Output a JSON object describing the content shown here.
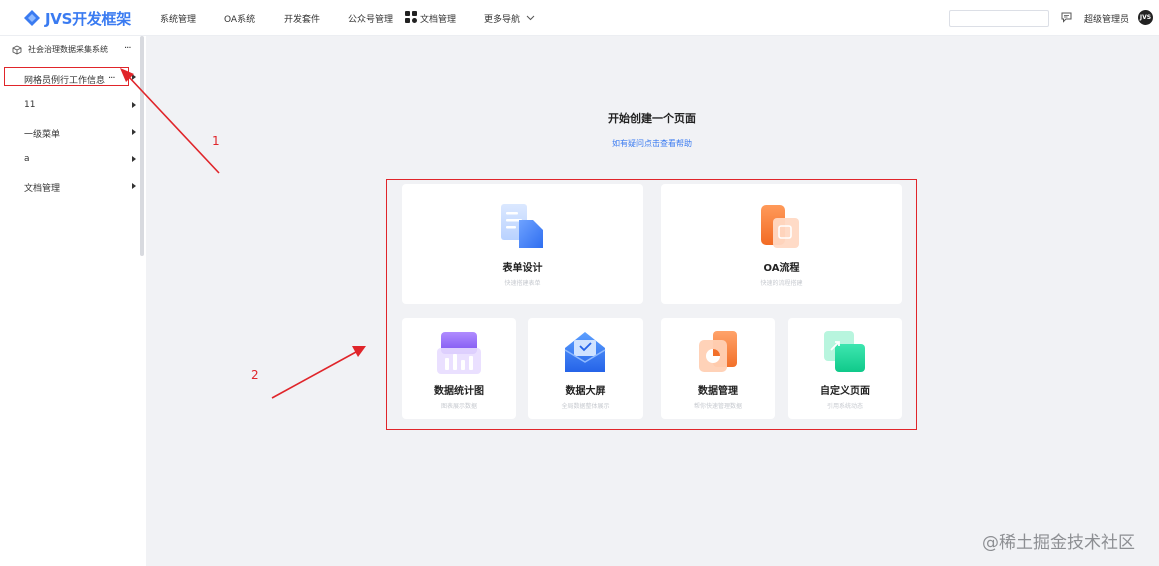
{
  "header": {
    "logo_text": "JVS开发框架",
    "nav": [
      "系统管理",
      "OA系统",
      "开发套件",
      "公众号管理",
      "文档管理",
      "更多导航"
    ],
    "user_name": "超级管理员",
    "avatar_text": "JVS",
    "accent": "#3a7bf1"
  },
  "sidebar": {
    "root_label": "社会治理数据采集系统",
    "root_more": "···",
    "items": [
      {
        "label": "网格员例行工作信息",
        "more": "···"
      },
      {
        "label": "11"
      },
      {
        "label": "一级菜单"
      },
      {
        "label": "a"
      },
      {
        "label": "文档管理"
      }
    ]
  },
  "main": {
    "title": "开始创建一个页面",
    "help_link": "如有疑问点击查看帮助",
    "cards": [
      {
        "label": "表单设计",
        "desc": "快速搭建表单",
        "icon": "form-design-icon"
      },
      {
        "label": "OA流程",
        "desc": "快速的流程搭建",
        "icon": "oa-flow-icon"
      },
      {
        "label": "数据统计图",
        "desc": "图表展示数据",
        "icon": "chart-icon"
      },
      {
        "label": "数据大屏",
        "desc": "全局数据整体展示",
        "icon": "big-screen-icon"
      },
      {
        "label": "数据管理",
        "desc": "帮你快速管理数据",
        "icon": "data-manage-icon"
      },
      {
        "label": "自定义页面",
        "desc": "引用系统动态",
        "icon": "custom-page-icon"
      }
    ]
  },
  "annotations": {
    "label_1": "1",
    "label_2": "2",
    "color": "#e0252a"
  },
  "watermark": "@稀土掘金技术社区"
}
